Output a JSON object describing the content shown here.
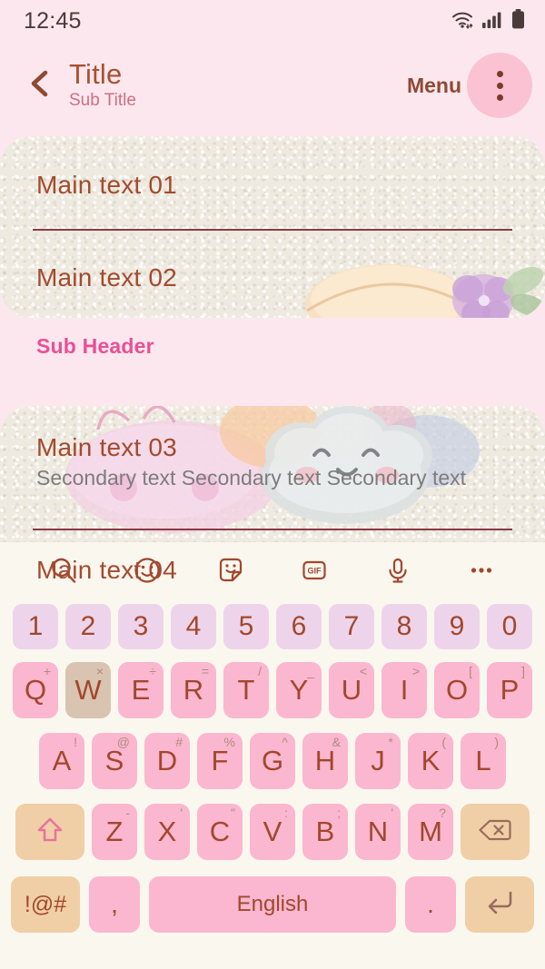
{
  "status_bar": {
    "time": "12:45",
    "icons": [
      "wifi-icon",
      "cellular-signal-icon",
      "battery-icon"
    ]
  },
  "app_bar": {
    "back_icon": "chevron-left-icon",
    "title": "Title",
    "subtitle": "Sub Title",
    "menu_label": "Menu",
    "overflow_icon": "more-vertical-icon"
  },
  "content": {
    "card1": {
      "items": [
        {
          "main": "Main text 01"
        },
        {
          "main": "Main text 02"
        }
      ]
    },
    "sub_header": "Sub Header",
    "card2": {
      "items": [
        {
          "main": "Main text 03",
          "secondary": "Secondary text Secondary text Secondary text"
        },
        {
          "main": "Main text 04"
        }
      ]
    }
  },
  "keyboard": {
    "toolbar": [
      {
        "name": "search-icon",
        "label": ""
      },
      {
        "name": "emoji-icon",
        "label": ""
      },
      {
        "name": "sticker-icon",
        "label": ""
      },
      {
        "name": "gif-icon",
        "label": "GIF"
      },
      {
        "name": "microphone-icon",
        "label": ""
      },
      {
        "name": "more-horizontal-icon",
        "label": ""
      }
    ],
    "number_row": [
      "1",
      "2",
      "3",
      "4",
      "5",
      "6",
      "7",
      "8",
      "9",
      "0"
    ],
    "row1": [
      {
        "key": "Q",
        "sup": "+"
      },
      {
        "key": "W",
        "sup": "×",
        "pressed": true
      },
      {
        "key": "E",
        "sup": "÷"
      },
      {
        "key": "R",
        "sup": "="
      },
      {
        "key": "T",
        "sup": "/"
      },
      {
        "key": "Y",
        "sup": "_"
      },
      {
        "key": "U",
        "sup": "<"
      },
      {
        "key": "I",
        "sup": ">"
      },
      {
        "key": "O",
        "sup": "["
      },
      {
        "key": "P",
        "sup": "]"
      }
    ],
    "row2": [
      {
        "key": "A",
        "sup": "!"
      },
      {
        "key": "S",
        "sup": "@"
      },
      {
        "key": "D",
        "sup": "#"
      },
      {
        "key": "F",
        "sup": "%"
      },
      {
        "key": "G",
        "sup": "^"
      },
      {
        "key": "H",
        "sup": "&"
      },
      {
        "key": "J",
        "sup": "*"
      },
      {
        "key": "K",
        "sup": "("
      },
      {
        "key": "L",
        "sup": ")"
      }
    ],
    "row3": [
      {
        "key": "Z",
        "sup": "-"
      },
      {
        "key": "X",
        "sup": "'"
      },
      {
        "key": "C",
        "sup": "\""
      },
      {
        "key": "V",
        "sup": ":"
      },
      {
        "key": "B",
        "sup": ";"
      },
      {
        "key": "N",
        "sup": "'"
      },
      {
        "key": "M",
        "sup": "?"
      }
    ],
    "shift_icon": "shift-arrow-icon",
    "backspace_icon": "backspace-icon",
    "symbols_label": "!@#",
    "comma_label": ",",
    "space_label": "English",
    "period_label": ".",
    "enter_icon": "enter-return-icon"
  },
  "colors": {
    "background": "#fce7ef",
    "card": "#eeeae0",
    "title": "#a8512f",
    "subtitle": "#cf6e83",
    "sub_header": "#ea4f93",
    "main_text": "#a44a2e",
    "secondary_text": "#7c7c7c",
    "divider": "#8b3a46",
    "keyboard_bg": "#faf7ef",
    "letter_key": "#fbb7cf",
    "number_key": "#eed4ea",
    "function_key": "#f0cfa6",
    "pressed_key": "#d9c3b1",
    "key_text": "#a2472c",
    "menu_circle": "#fac2d3"
  }
}
